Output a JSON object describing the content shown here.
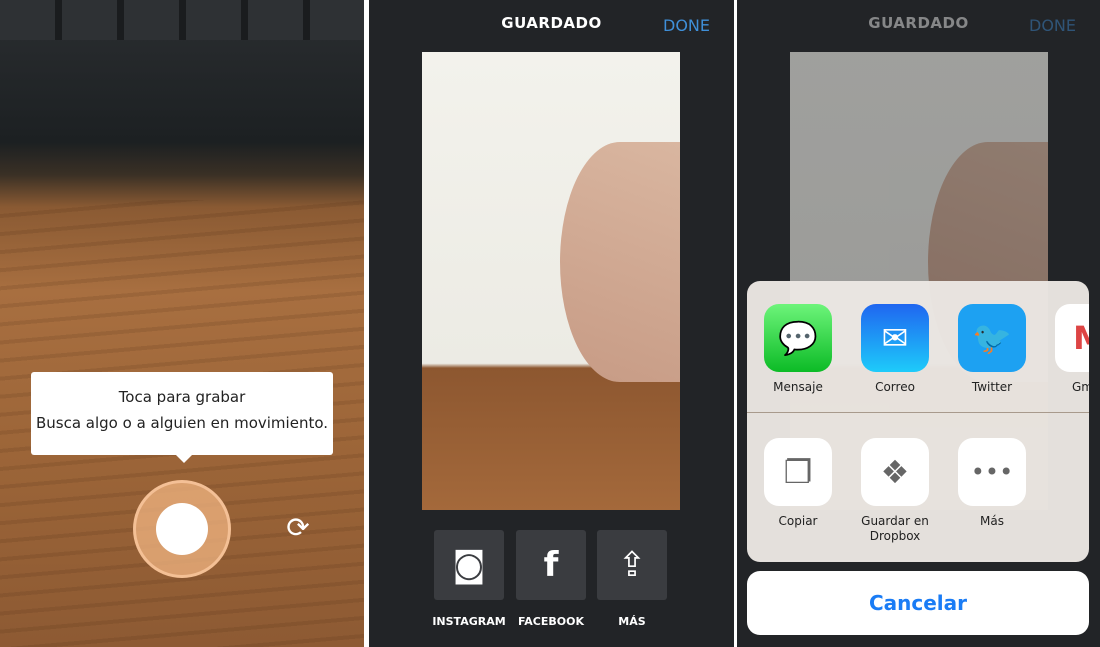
{
  "camera": {
    "tooltip_title": "Toca para grabar",
    "tooltip_text": "Busca algo o a alguien en movimiento."
  },
  "saved": {
    "title": "GUARDADO",
    "done": "DONE",
    "share": [
      {
        "label": "INSTAGRAM",
        "icon": "instagram-icon"
      },
      {
        "label": "FACEBOOK",
        "icon": "facebook-icon"
      },
      {
        "label": "MÁS",
        "icon": "share-icon"
      }
    ]
  },
  "sheet": {
    "title": "GUARDADO",
    "done": "DONE",
    "apps": [
      {
        "label": "Mensaje",
        "icon": "messages-icon",
        "color": "#2fcf47"
      },
      {
        "label": "Correo",
        "icon": "mail-icon",
        "color": "#1f8ef5"
      },
      {
        "label": "Twitter",
        "icon": "twitter-icon",
        "color": "#1da1f2"
      },
      {
        "label": "Gm",
        "icon": "gmail-icon",
        "color": "#ffffff"
      }
    ],
    "actions": [
      {
        "label": "Copiar",
        "icon": "copy-icon"
      },
      {
        "label": "Guardar en Dropbox",
        "icon": "dropbox-icon"
      },
      {
        "label": "Más",
        "icon": "more-icon"
      }
    ],
    "cancel": "Cancelar"
  }
}
